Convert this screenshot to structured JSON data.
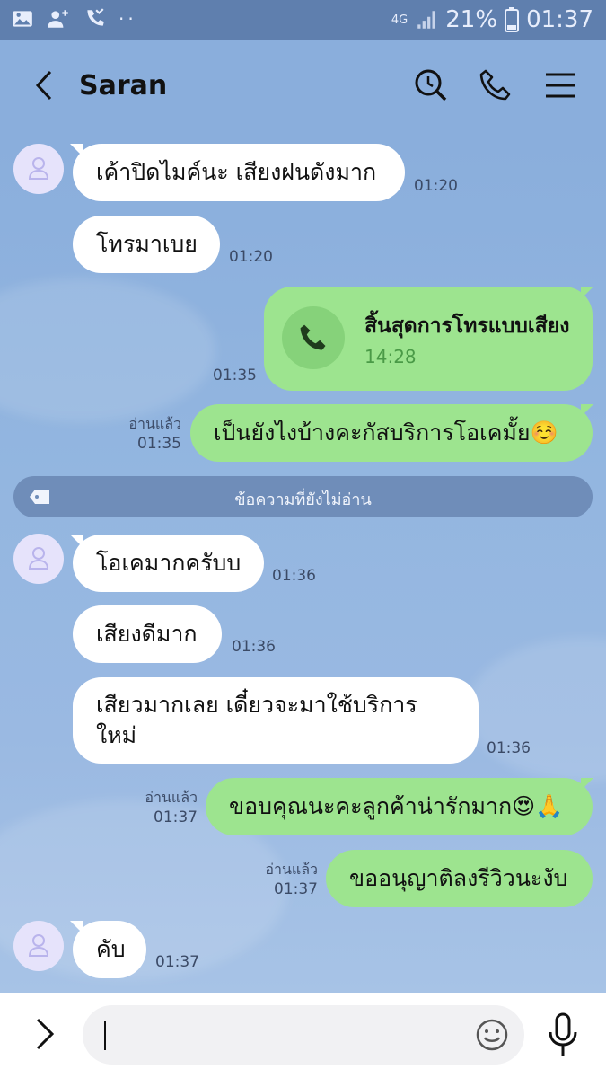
{
  "status_bar": {
    "battery": "21%",
    "time": "01:37",
    "network": "4G"
  },
  "header": {
    "contact_name": "Saran"
  },
  "messages": {
    "m1": {
      "text": "เค้าปิดไมค์นะ เสียงฝนดังมาก",
      "time": "01:20"
    },
    "m2": {
      "text": "โทรมาเบย",
      "time": "01:20"
    },
    "call": {
      "title": "สิ้นสุดการโทรแบบเสียง",
      "duration": "14:28",
      "time": "01:35"
    },
    "m4": {
      "text": "เป็นยังไงบ้างคะกัสบริการโอเคมั้ย☺️",
      "read": "อ่านแล้ว",
      "time": "01:35"
    },
    "m5": {
      "text": "โอเคมากครับบ",
      "time": "01:36"
    },
    "m6": {
      "text": "เสียงดีมาก",
      "time": "01:36"
    },
    "m7": {
      "line1": "เสียวมากเลย เดี๋ยวจะมาใช้บริการ",
      "line2": "ใหม่",
      "time": "01:36"
    },
    "m8": {
      "text": "ขอบคุณนะคะลูกค้าน่ารักมาก😍🙏",
      "read": "อ่านแล้ว",
      "time": "01:37"
    },
    "m9": {
      "text": "ขออนุญาติลงรีวิวนะงับ",
      "read": "อ่านแล้ว",
      "time": "01:37"
    },
    "m10": {
      "text": "คับ",
      "time": "01:37"
    }
  },
  "unread_divider": {
    "label": "ข้อความที่ยังไม่อ่าน"
  },
  "input": {
    "value": ""
  }
}
